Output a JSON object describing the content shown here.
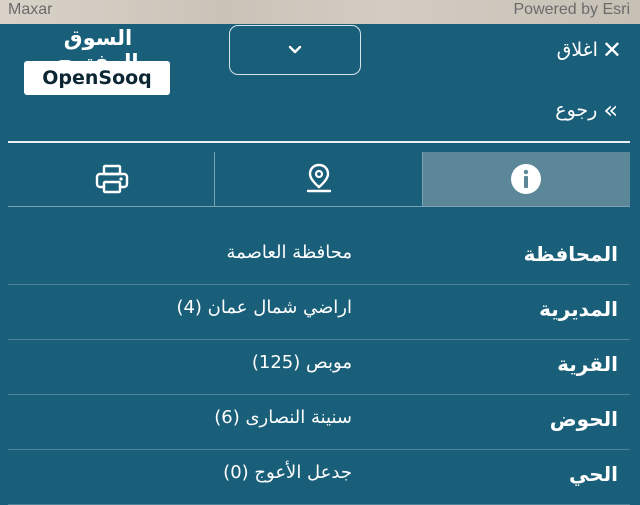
{
  "map": {
    "attribution_left": "Maxar",
    "attribution_right": "Powered by Esri"
  },
  "brand": {
    "arabic_name": "السوق المفتوح",
    "latin_name": "OpenSooq"
  },
  "header": {
    "dropdown_icon": "chevron-down-icon",
    "close_label": "اغلاق",
    "back_label": "رجوع"
  },
  "tabs": [
    {
      "icon": "printer-icon",
      "active": false
    },
    {
      "icon": "map-pin-icon",
      "active": false
    },
    {
      "icon": "info-icon",
      "active": true
    }
  ],
  "details": [
    {
      "label": "المحافظة",
      "value": "محافظة العاصمة"
    },
    {
      "label": "المديرية",
      "value": "اراضي شمال عمان (4)"
    },
    {
      "label": "القرية",
      "value": "موبص (125)"
    },
    {
      "label": "الحوض",
      "value": "سنينة النصارى (6)"
    },
    {
      "label": "الحي",
      "value": "جدعل الأعوج (0)"
    }
  ],
  "colors": {
    "panel_bg": "#1a5f7a",
    "active_tab_bg": "#5c8799",
    "divider": "#e9eff2"
  }
}
